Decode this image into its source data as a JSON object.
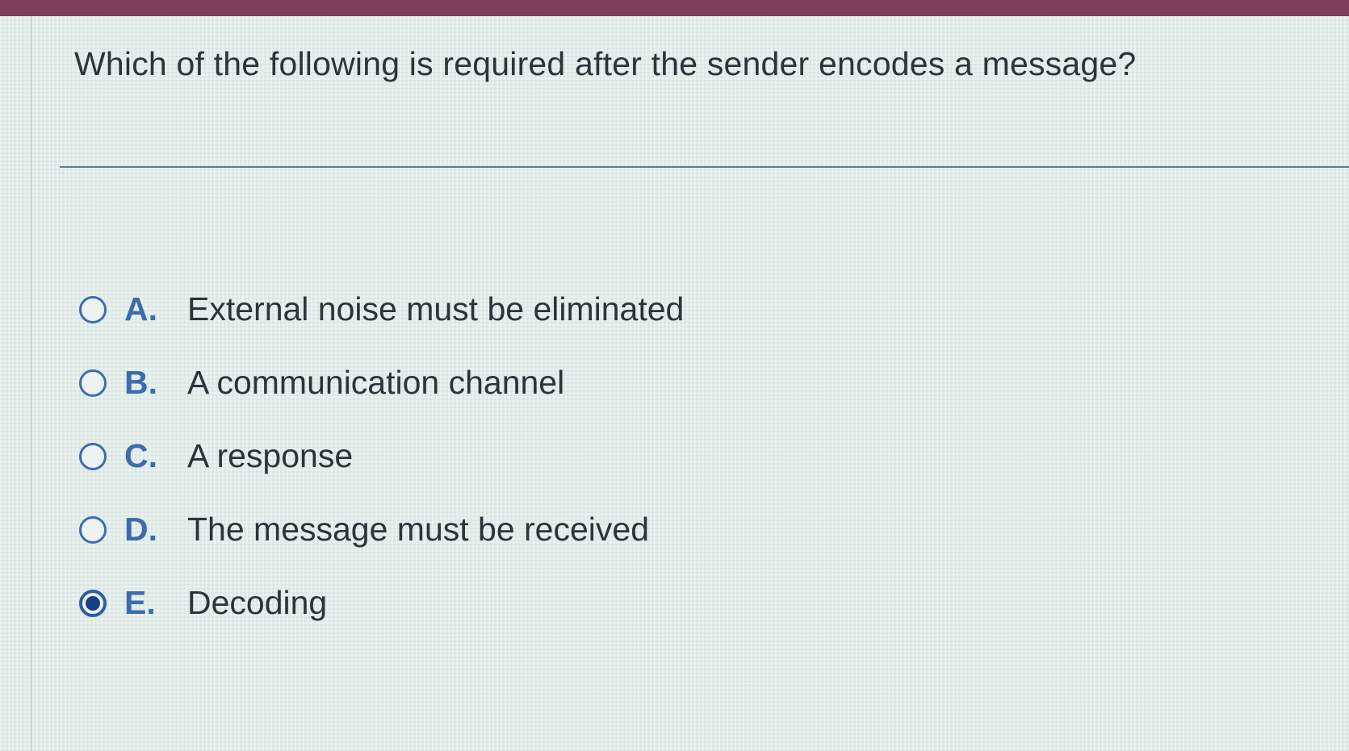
{
  "question": {
    "text": "Which of the following is required after the sender encodes a message?"
  },
  "options": [
    {
      "letter": "A.",
      "text": "External noise must be eliminated",
      "selected": false
    },
    {
      "letter": "B.",
      "text": "A communication channel",
      "selected": false
    },
    {
      "letter": "C.",
      "text": "A response",
      "selected": false
    },
    {
      "letter": "D.",
      "text": "The message must be received",
      "selected": false
    },
    {
      "letter": "E.",
      "text": "Decoding",
      "selected": true
    }
  ],
  "colors": {
    "accent": "#3c6cae",
    "header_bar": "#7d3f5a"
  }
}
